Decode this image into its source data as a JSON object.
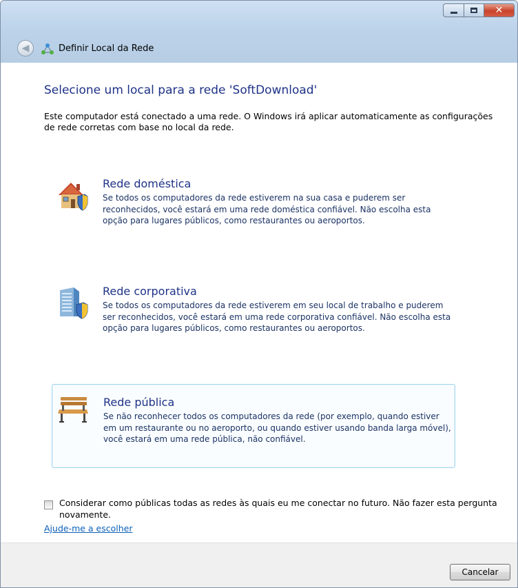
{
  "window": {
    "title": "Definir Local da Rede",
    "controls": {
      "minimize": "minimize-icon",
      "maximize": "maximize-icon",
      "close": "close-icon"
    }
  },
  "page": {
    "heading": "Selecione um local para a rede 'SoftDownload'",
    "intro": "Este computador está conectado a uma rede. O Windows irá aplicar automaticamente as configurações de rede corretas com base no local da rede."
  },
  "options": [
    {
      "id": "home",
      "icon": "house-icon",
      "title": "Rede doméstica",
      "description": "Se todos os computadores da rede estiverem na sua casa e puderem ser reconhecidos, você estará em uma rede doméstica confiável. Não escolha esta opção para lugares públicos, como restaurantes ou aeroportos."
    },
    {
      "id": "work",
      "icon": "office-building-icon",
      "title": "Rede corporativa",
      "description": "Se todos os computadores da rede estiverem em seu local de trabalho e puderem ser reconhecidos, você estará em uma rede corporativa confiável. Não escolha esta opção para lugares públicos, como restaurantes ou aeroportos."
    },
    {
      "id": "public",
      "icon": "park-bench-icon",
      "title": "Rede pública",
      "description": "Se não reconhecer todos os computadores da rede (por exemplo, quando estiver em um restaurante ou no aeroporto, ou quando estiver usando banda larga móvel), você estará em uma rede pública, não confiável.",
      "highlighted": true
    }
  ],
  "checkbox": {
    "label": "Considerar como públicas todas as redes às quais eu me conectar no futuro. Não fazer esta pergunta novamente.",
    "checked": false
  },
  "help_link": "Ajude-me a escolher",
  "footer": {
    "cancel_label": "Cancelar"
  },
  "colors": {
    "heading": "#1e3287",
    "link": "#0b5fb8",
    "selection_border": "#a6d8f1"
  }
}
